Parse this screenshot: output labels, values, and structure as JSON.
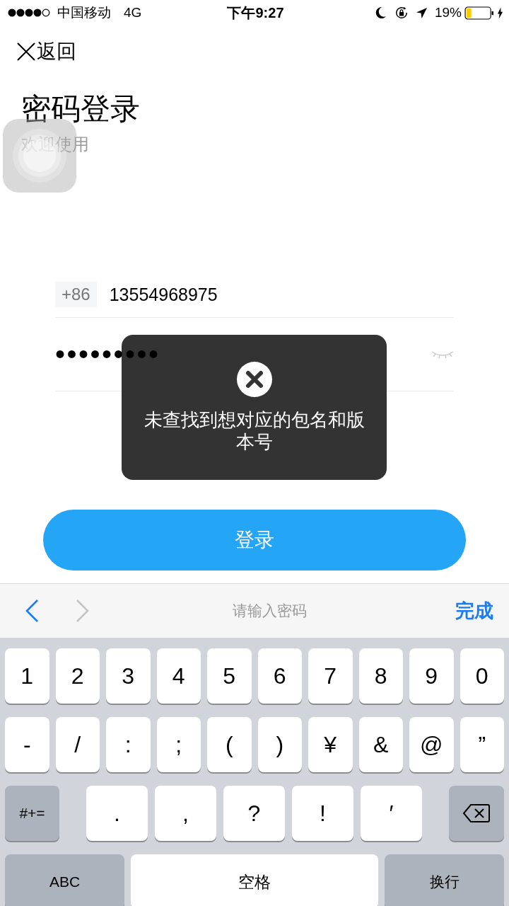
{
  "status_bar": {
    "carrier": "中国移动",
    "network": "4G",
    "time": "下午9:27",
    "battery": "19%"
  },
  "nav": {
    "back": "返回"
  },
  "header": {
    "title": "密码登录",
    "subtitle": "欢迎使用"
  },
  "form": {
    "country_code": "+86",
    "phone": "13554968975",
    "password": "•••••••••"
  },
  "login_button": "登录",
  "toast": {
    "message": "未查找到想对应的包名和版本号"
  },
  "keyboard_toolbar": {
    "prev": {
      "disabled": false
    },
    "next": {
      "disabled": true
    },
    "hint": "请输入密码",
    "done": "完成"
  },
  "keyboard": {
    "rows": [
      {
        "keys": [
          {
            "kind": "char",
            "label": "1"
          },
          {
            "kind": "char",
            "label": "2"
          },
          {
            "kind": "char",
            "label": "3"
          },
          {
            "kind": "char",
            "label": "4"
          },
          {
            "kind": "char",
            "label": "5"
          },
          {
            "kind": "char",
            "label": "6"
          },
          {
            "kind": "char",
            "label": "7"
          },
          {
            "kind": "char",
            "label": "8"
          },
          {
            "kind": "char",
            "label": "9"
          },
          {
            "kind": "char",
            "label": "0"
          }
        ]
      },
      {
        "keys": [
          {
            "kind": "char",
            "label": "-"
          },
          {
            "kind": "char",
            "label": "/"
          },
          {
            "kind": "char",
            "label": ":"
          },
          {
            "kind": "char",
            "label": ";"
          },
          {
            "kind": "char",
            "label": "("
          },
          {
            "kind": "char",
            "label": ")"
          },
          {
            "kind": "char",
            "label": "¥"
          },
          {
            "kind": "char",
            "label": "&"
          },
          {
            "kind": "char",
            "label": "@"
          },
          {
            "kind": "char",
            "label": "”"
          }
        ]
      },
      {
        "keys": [
          {
            "kind": "function",
            "label": "#+="
          },
          {
            "kind": "char",
            "label": "."
          },
          {
            "kind": "char",
            "label": ","
          },
          {
            "kind": "char",
            "label": "?"
          },
          {
            "kind": "char",
            "label": "!"
          },
          {
            "kind": "char",
            "label": "′"
          },
          {
            "kind": "delete"
          }
        ]
      },
      {
        "keys": [
          {
            "kind": "function",
            "label": "ABC"
          },
          {
            "kind": "space",
            "label": "空格"
          },
          {
            "kind": "function",
            "label": "换行"
          }
        ]
      }
    ]
  }
}
